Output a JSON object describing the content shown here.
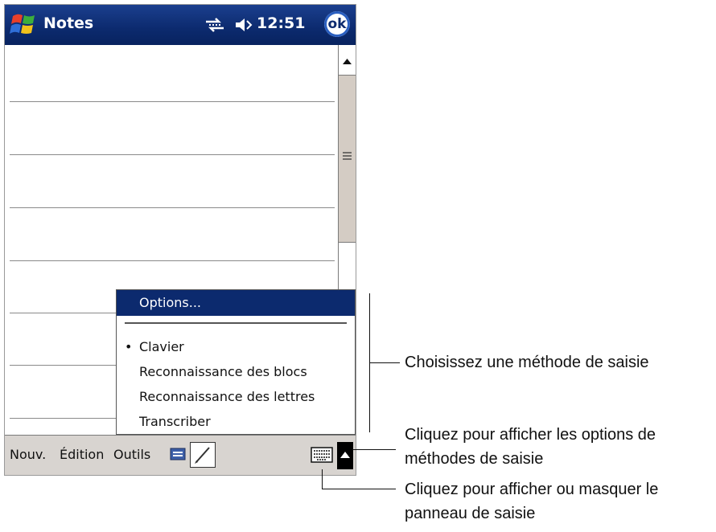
{
  "titlebar": {
    "app_title": "Notes",
    "clock": "12:51",
    "ok_label": "ok",
    "start_icon": "windows-flag-icon",
    "connectivity_icon": "connectivity-icon",
    "volume_icon": "speaker-icon"
  },
  "input_menu": {
    "items": [
      {
        "label": "Options...",
        "selected": true
      },
      {
        "label": "Clavier",
        "checked": true
      },
      {
        "label": "Reconnaissance des blocs"
      },
      {
        "label": "Reconnaissance des lettres"
      },
      {
        "label": "Transcriber"
      }
    ]
  },
  "menubar": {
    "new": "Nouv.",
    "edit": "Édition",
    "tools": "Outils",
    "keyboard_icon": "keyboard-icon",
    "pen_icon": "pen-icon",
    "input_arrow_icon": "triangle-up-icon"
  },
  "annotations": {
    "choose_method": "Choisissez une méthode de saisie",
    "options_line1": "Cliquez pour afficher les options de",
    "options_line2": "méthodes de saisie",
    "panel_line1": "Cliquez pour afficher ou masquer le",
    "panel_line2": "panneau de saisie"
  },
  "colors": {
    "titlebar": "#0c2a6e",
    "menubar": "#d8d4d0",
    "selection": "#0c2a6e",
    "scroll_thumb": "#d4ccc4"
  }
}
